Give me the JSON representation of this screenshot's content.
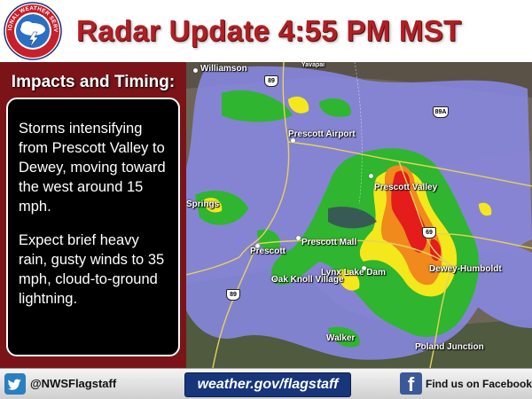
{
  "header": {
    "title": "Radar Update 4:55 PM MST",
    "logo_text": "NATIONAL WEATHER SERVICE",
    "logo_icon": "nws-logo-icon"
  },
  "panel": {
    "heading": "Impacts and Timing:",
    "paragraphs": [
      "Storms intensifying from Prescott Valley to Dewey, moving toward the west around 15 mph.",
      "Expect brief heavy rain, gusty winds to 35 mph, cloud-to-ground lightning."
    ]
  },
  "map": {
    "places": {
      "williamson": "Williamson",
      "yavapai": "Yavapai",
      "prescott_airport": "Prescott Airport",
      "prescott_valley": "Prescott Valley",
      "springs": "Springs",
      "prescott_mall": "Prescott Mall",
      "prescott": "Prescott",
      "lynx_lake_dam": "Lynx Lake Dam",
      "dewey_humboldt": "Dewey-Humboldt",
      "oak_knoll_village": "Oak Knoll Village",
      "walker": "Walker",
      "poland_junction": "Poland Junction"
    },
    "shields": {
      "route_89_north": "89",
      "route_89a": "89A",
      "route_69": "69",
      "route_89_south": "89"
    },
    "colors": {
      "light": "#8a8ae8",
      "green": "#2fb52f",
      "yellow": "#f4e81c",
      "orange": "#f08a1c",
      "red": "#e41c1c"
    }
  },
  "footer": {
    "twitter_handle": "@NWSFlagstaff",
    "twitter_icon": "twitter-bird-icon",
    "website": "weather.gov/flagstaff",
    "facebook_letter": "f",
    "facebook_text": "Find us on Facebook",
    "facebook_icon": "facebook-icon"
  }
}
